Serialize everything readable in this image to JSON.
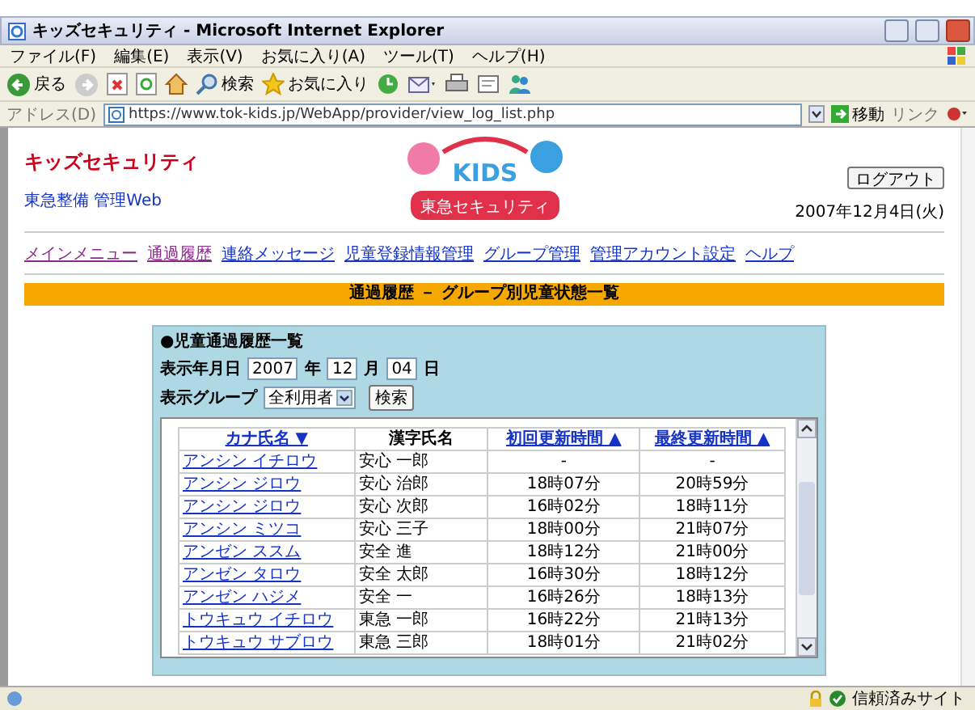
{
  "window": {
    "title": "キッズセキュリティ - Microsoft Internet Explorer"
  },
  "menu": [
    "ファイル(F)",
    "編集(E)",
    "表示(V)",
    "お気に入り(A)",
    "ツール(T)",
    "ヘルプ(H)"
  ],
  "toolbar": {
    "back": "戻る",
    "search": "検索",
    "favorites": "お気に入り"
  },
  "address_bar": {
    "label": "アドレス(D)",
    "url": "https://www.tok-kids.jp/WebApp/provider/view_log_list.php",
    "go": "移動",
    "links": "リンク"
  },
  "page": {
    "site_title": "キッズセキュリティ",
    "subtitle": "東急整備 管理Web",
    "logo_text": "KIDS",
    "logo_sub": "東急セキュリティ",
    "logout": "ログアウト",
    "date": "2007年12月4日(火)",
    "nav": [
      {
        "label": "メインメニュー",
        "visited": true
      },
      {
        "label": "通過履歴",
        "visited": true
      },
      {
        "label": "連絡メッセージ",
        "visited": false
      },
      {
        "label": "児童登録情報管理",
        "visited": false
      },
      {
        "label": "グループ管理",
        "visited": false
      },
      {
        "label": "管理アカウント設定",
        "visited": false
      },
      {
        "label": "ヘルプ",
        "visited": false
      }
    ],
    "heading": "通過履歴 － グループ別児童状態一覧",
    "panel": {
      "title": "●児童通過履歴一覧",
      "date_label": "表示年月日",
      "year": "2007",
      "year_unit": "年",
      "month": "12",
      "month_unit": "月",
      "day": "04",
      "day_unit": "日",
      "group_label": "表示グループ",
      "group": "全利用者",
      "search_button": "検索",
      "table": {
        "columns": [
          {
            "label": "カナ氏名 ▼",
            "sortable": true
          },
          {
            "label": "漢字氏名",
            "sortable": false
          },
          {
            "label": "初回更新時間 ▲",
            "sortable": true
          },
          {
            "label": "最終更新時間 ▲",
            "sortable": true
          }
        ],
        "rows": [
          [
            "アンシン イチロウ",
            "安心 一郎",
            "-",
            "-"
          ],
          [
            "アンシン ジロウ",
            "安心 治郎",
            "18時07分",
            "20時59分"
          ],
          [
            "アンシン ジロウ",
            "安心 次郎",
            "16時02分",
            "18時11分"
          ],
          [
            "アンシン ミツコ",
            "安心 三子",
            "18時00分",
            "21時07分"
          ],
          [
            "アンゼン ススム",
            "安全 進",
            "18時12分",
            "21時00分"
          ],
          [
            "アンゼン タロウ",
            "安全 太郎",
            "16時30分",
            "18時12分"
          ],
          [
            "アンゼン ハジメ",
            "安全 一",
            "16時26分",
            "18時13分"
          ],
          [
            "トウキュウ イチロウ",
            "東急 一郎",
            "16時22分",
            "21時13分"
          ],
          [
            "トウキュウ サブロウ",
            "東急 三郎",
            "18時01分",
            "21時02分"
          ]
        ]
      }
    }
  },
  "status_bar": {
    "zone": "信頼済みサイト"
  }
}
